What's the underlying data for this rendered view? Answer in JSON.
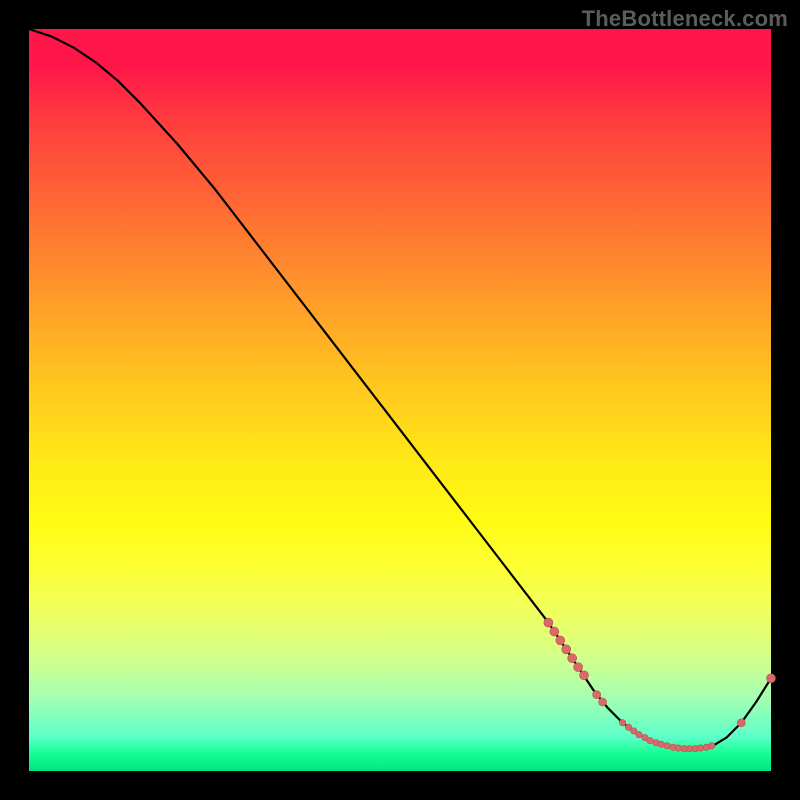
{
  "watermark": "TheBottleneck.com",
  "colors": {
    "curve": "#000000",
    "marker": "#d86a6a",
    "marker_stroke": "#bb4f4f"
  },
  "chart_data": {
    "type": "line",
    "title": "",
    "xlabel": "",
    "ylabel": "",
    "xlim": [
      0,
      100
    ],
    "ylim": [
      0,
      100
    ],
    "grid": false,
    "legend": false,
    "series": [
      {
        "name": "curve",
        "x": [
          0,
          3,
          6,
          9,
          12,
          15,
          20,
          25,
          30,
          35,
          40,
          45,
          50,
          55,
          60,
          65,
          70,
          74,
          76,
          78,
          80,
          82,
          84,
          86,
          88,
          90,
          92,
          94,
          96,
          98,
          100
        ],
        "y": [
          100,
          99,
          97.5,
          95.5,
          93,
          90,
          84.5,
          78.5,
          72,
          65.5,
          59,
          52.5,
          46,
          39.5,
          33,
          26.5,
          20,
          14,
          11,
          8.5,
          6.5,
          5,
          4,
          3.3,
          3,
          3,
          3.3,
          4.5,
          6.5,
          9.3,
          12.5
        ]
      }
    ],
    "markers": [
      {
        "x": 70.0,
        "y": 20.0,
        "r": 4.5
      },
      {
        "x": 70.8,
        "y": 18.8,
        "r": 4.5
      },
      {
        "x": 71.6,
        "y": 17.6,
        "r": 4.5
      },
      {
        "x": 72.4,
        "y": 16.4,
        "r": 4.5
      },
      {
        "x": 73.2,
        "y": 15.2,
        "r": 4.5
      },
      {
        "x": 74.0,
        "y": 14.0,
        "r": 4.5
      },
      {
        "x": 74.8,
        "y": 12.9,
        "r": 4.5
      },
      {
        "x": 76.5,
        "y": 10.3,
        "r": 4.0
      },
      {
        "x": 77.3,
        "y": 9.3,
        "r": 4.0
      },
      {
        "x": 80.0,
        "y": 6.5,
        "r": 3.2
      },
      {
        "x": 80.8,
        "y": 5.9,
        "r": 3.2
      },
      {
        "x": 81.5,
        "y": 5.4,
        "r": 3.2
      },
      {
        "x": 82.2,
        "y": 4.9,
        "r": 3.2
      },
      {
        "x": 83.0,
        "y": 4.5,
        "r": 3.2
      },
      {
        "x": 83.7,
        "y": 4.1,
        "r": 3.2
      },
      {
        "x": 84.5,
        "y": 3.8,
        "r": 3.2
      },
      {
        "x": 85.2,
        "y": 3.6,
        "r": 3.2
      },
      {
        "x": 86.0,
        "y": 3.4,
        "r": 3.2
      },
      {
        "x": 86.8,
        "y": 3.2,
        "r": 3.2
      },
      {
        "x": 87.5,
        "y": 3.1,
        "r": 3.2
      },
      {
        "x": 88.3,
        "y": 3.0,
        "r": 3.2
      },
      {
        "x": 89.0,
        "y": 3.0,
        "r": 3.2
      },
      {
        "x": 89.8,
        "y": 3.0,
        "r": 3.2
      },
      {
        "x": 90.5,
        "y": 3.1,
        "r": 3.2
      },
      {
        "x": 91.3,
        "y": 3.2,
        "r": 3.2
      },
      {
        "x": 92.0,
        "y": 3.4,
        "r": 3.2
      },
      {
        "x": 96.0,
        "y": 6.5,
        "r": 4.0
      },
      {
        "x": 100.0,
        "y": 12.5,
        "r": 4.5
      }
    ]
  }
}
